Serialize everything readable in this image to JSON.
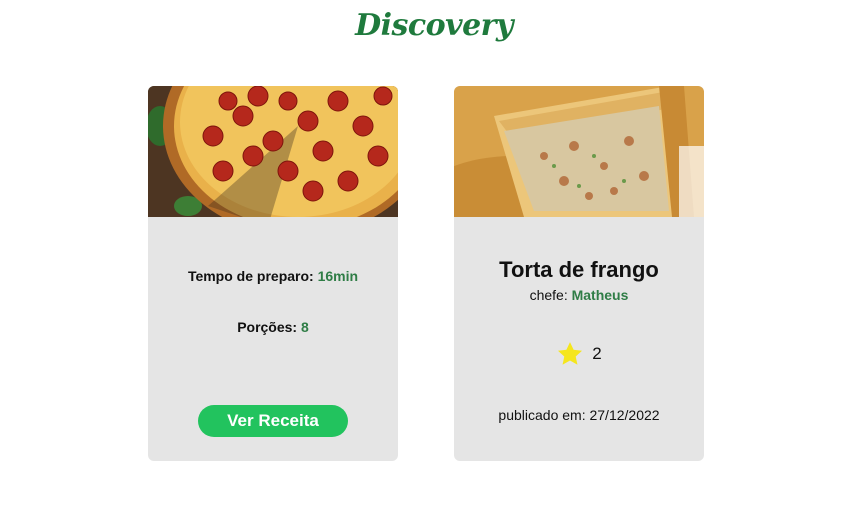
{
  "page": {
    "title": "Discovery"
  },
  "cards": [
    {
      "image_alt": "Pizza de pepperoni",
      "prep_label": "Tempo de preparo:",
      "prep_value": "16min",
      "servings_label": "Porções:",
      "servings_value": "8",
      "button_label": "Ver Receita"
    },
    {
      "image_alt": "Torta de frango",
      "name": "Torta de frango",
      "chef_label": "chefe:",
      "chef_name": "Matheus",
      "rating_count": "2",
      "published_label": "publicado em:",
      "published_date": "27/12/2022"
    }
  ],
  "colors": {
    "brand_green": "#1f7a3d",
    "button_green": "#22c35e",
    "card_bg": "#e5e5e5",
    "star": "#f5e61d"
  },
  "icons": [
    "star-icon"
  ]
}
